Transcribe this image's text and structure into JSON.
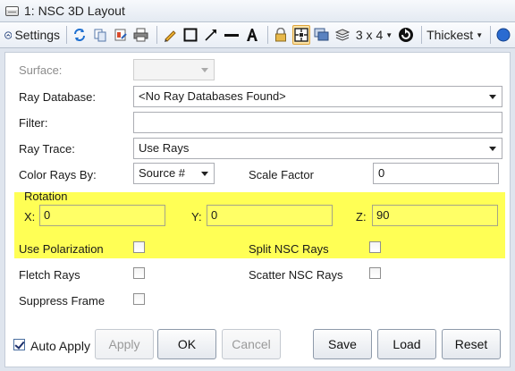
{
  "window": {
    "title": "1: NSC 3D Layout",
    "icon": "window-icon"
  },
  "toolbar": {
    "settings_label": "Settings",
    "grid_label": "3 x 4",
    "thickness_label": "Thickest",
    "icons": [
      "settings-chevron-icon",
      "refresh-icon",
      "copy-icon",
      "export-icon",
      "print-icon",
      "pencil-icon",
      "rectangle-icon",
      "arrow-icon",
      "line-icon",
      "text-icon",
      "lock-icon",
      "layout-icon",
      "window-stack-icon",
      "layers-icon",
      "reset-icon",
      "help-icon"
    ]
  },
  "form": {
    "surface_label": "Surface:",
    "surface_value": "",
    "ray_database_label": "Ray Database:",
    "ray_database_value": "<No Ray Databases Found>",
    "filter_label": "Filter:",
    "filter_value": "",
    "ray_trace_label": "Ray Trace:",
    "ray_trace_value": "Use Rays",
    "color_rays_label": "Color Rays By:",
    "color_rays_value": "Source #",
    "scale_factor_label": "Scale Factor",
    "scale_factor_value": "0",
    "rotation_label": "Rotation",
    "rot_x_label": "X:",
    "rot_x_value": "0",
    "rot_y_label": "Y:",
    "rot_y_value": "0",
    "rot_z_label": "Z:",
    "rot_z_value": "90",
    "use_polarization_label": "Use Polarization",
    "split_nsc_label": "Split NSC Rays",
    "fletch_rays_label": "Fletch Rays",
    "scatter_nsc_label": "Scatter NSC Rays",
    "suppress_frame_label": "Suppress Frame"
  },
  "footer": {
    "auto_apply_label": "Auto Apply",
    "auto_apply_checked": true,
    "apply_label": "Apply",
    "ok_label": "OK",
    "cancel_label": "Cancel",
    "save_label": "Save",
    "load_label": "Load",
    "reset_label": "Reset"
  },
  "colors": {
    "highlight": "#ffff55",
    "active_tool": "#fbe3a6",
    "background": "#dfe5ee"
  }
}
